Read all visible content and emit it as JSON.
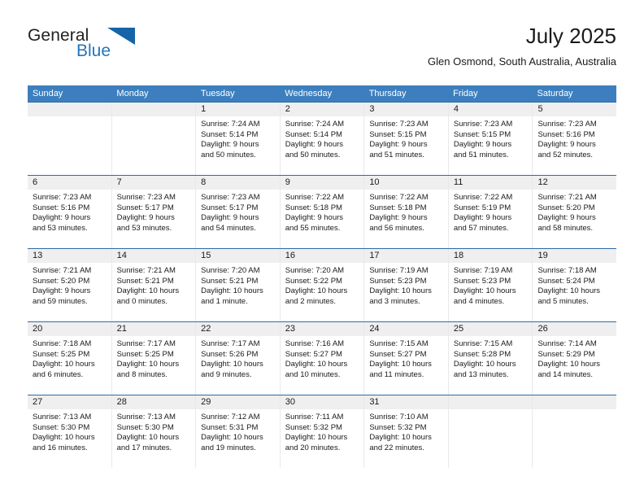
{
  "brand": {
    "word1": "General",
    "word2": "Blue",
    "triangle_color": "#1664a8",
    "blue_color": "#2176bd"
  },
  "header": {
    "title": "July 2025",
    "location": "Glen Osmond, South Australia, Australia"
  },
  "theme": {
    "header_row_bg": "#3d7fbe",
    "week_divider": "#2c6ca8",
    "daynum_strip_bg": "#efefef"
  },
  "weekdays": [
    "Sunday",
    "Monday",
    "Tuesday",
    "Wednesday",
    "Thursday",
    "Friday",
    "Saturday"
  ],
  "weeks": [
    [
      {
        "day": "",
        "sunrise": "",
        "sunset": "",
        "daylight1": "",
        "daylight2": ""
      },
      {
        "day": "",
        "sunrise": "",
        "sunset": "",
        "daylight1": "",
        "daylight2": ""
      },
      {
        "day": "1",
        "sunrise": "Sunrise: 7:24 AM",
        "sunset": "Sunset: 5:14 PM",
        "daylight1": "Daylight: 9 hours",
        "daylight2": "and 50 minutes."
      },
      {
        "day": "2",
        "sunrise": "Sunrise: 7:24 AM",
        "sunset": "Sunset: 5:14 PM",
        "daylight1": "Daylight: 9 hours",
        "daylight2": "and 50 minutes."
      },
      {
        "day": "3",
        "sunrise": "Sunrise: 7:23 AM",
        "sunset": "Sunset: 5:15 PM",
        "daylight1": "Daylight: 9 hours",
        "daylight2": "and 51 minutes."
      },
      {
        "day": "4",
        "sunrise": "Sunrise: 7:23 AM",
        "sunset": "Sunset: 5:15 PM",
        "daylight1": "Daylight: 9 hours",
        "daylight2": "and 51 minutes."
      },
      {
        "day": "5",
        "sunrise": "Sunrise: 7:23 AM",
        "sunset": "Sunset: 5:16 PM",
        "daylight1": "Daylight: 9 hours",
        "daylight2": "and 52 minutes."
      }
    ],
    [
      {
        "day": "6",
        "sunrise": "Sunrise: 7:23 AM",
        "sunset": "Sunset: 5:16 PM",
        "daylight1": "Daylight: 9 hours",
        "daylight2": "and 53 minutes."
      },
      {
        "day": "7",
        "sunrise": "Sunrise: 7:23 AM",
        "sunset": "Sunset: 5:17 PM",
        "daylight1": "Daylight: 9 hours",
        "daylight2": "and 53 minutes."
      },
      {
        "day": "8",
        "sunrise": "Sunrise: 7:23 AM",
        "sunset": "Sunset: 5:17 PM",
        "daylight1": "Daylight: 9 hours",
        "daylight2": "and 54 minutes."
      },
      {
        "day": "9",
        "sunrise": "Sunrise: 7:22 AM",
        "sunset": "Sunset: 5:18 PM",
        "daylight1": "Daylight: 9 hours",
        "daylight2": "and 55 minutes."
      },
      {
        "day": "10",
        "sunrise": "Sunrise: 7:22 AM",
        "sunset": "Sunset: 5:18 PM",
        "daylight1": "Daylight: 9 hours",
        "daylight2": "and 56 minutes."
      },
      {
        "day": "11",
        "sunrise": "Sunrise: 7:22 AM",
        "sunset": "Sunset: 5:19 PM",
        "daylight1": "Daylight: 9 hours",
        "daylight2": "and 57 minutes."
      },
      {
        "day": "12",
        "sunrise": "Sunrise: 7:21 AM",
        "sunset": "Sunset: 5:20 PM",
        "daylight1": "Daylight: 9 hours",
        "daylight2": "and 58 minutes."
      }
    ],
    [
      {
        "day": "13",
        "sunrise": "Sunrise: 7:21 AM",
        "sunset": "Sunset: 5:20 PM",
        "daylight1": "Daylight: 9 hours",
        "daylight2": "and 59 minutes."
      },
      {
        "day": "14",
        "sunrise": "Sunrise: 7:21 AM",
        "sunset": "Sunset: 5:21 PM",
        "daylight1": "Daylight: 10 hours",
        "daylight2": "and 0 minutes."
      },
      {
        "day": "15",
        "sunrise": "Sunrise: 7:20 AM",
        "sunset": "Sunset: 5:21 PM",
        "daylight1": "Daylight: 10 hours",
        "daylight2": "and 1 minute."
      },
      {
        "day": "16",
        "sunrise": "Sunrise: 7:20 AM",
        "sunset": "Sunset: 5:22 PM",
        "daylight1": "Daylight: 10 hours",
        "daylight2": "and 2 minutes."
      },
      {
        "day": "17",
        "sunrise": "Sunrise: 7:19 AM",
        "sunset": "Sunset: 5:23 PM",
        "daylight1": "Daylight: 10 hours",
        "daylight2": "and 3 minutes."
      },
      {
        "day": "18",
        "sunrise": "Sunrise: 7:19 AM",
        "sunset": "Sunset: 5:23 PM",
        "daylight1": "Daylight: 10 hours",
        "daylight2": "and 4 minutes."
      },
      {
        "day": "19",
        "sunrise": "Sunrise: 7:18 AM",
        "sunset": "Sunset: 5:24 PM",
        "daylight1": "Daylight: 10 hours",
        "daylight2": "and 5 minutes."
      }
    ],
    [
      {
        "day": "20",
        "sunrise": "Sunrise: 7:18 AM",
        "sunset": "Sunset: 5:25 PM",
        "daylight1": "Daylight: 10 hours",
        "daylight2": "and 6 minutes."
      },
      {
        "day": "21",
        "sunrise": "Sunrise: 7:17 AM",
        "sunset": "Sunset: 5:25 PM",
        "daylight1": "Daylight: 10 hours",
        "daylight2": "and 8 minutes."
      },
      {
        "day": "22",
        "sunrise": "Sunrise: 7:17 AM",
        "sunset": "Sunset: 5:26 PM",
        "daylight1": "Daylight: 10 hours",
        "daylight2": "and 9 minutes."
      },
      {
        "day": "23",
        "sunrise": "Sunrise: 7:16 AM",
        "sunset": "Sunset: 5:27 PM",
        "daylight1": "Daylight: 10 hours",
        "daylight2": "and 10 minutes."
      },
      {
        "day": "24",
        "sunrise": "Sunrise: 7:15 AM",
        "sunset": "Sunset: 5:27 PM",
        "daylight1": "Daylight: 10 hours",
        "daylight2": "and 11 minutes."
      },
      {
        "day": "25",
        "sunrise": "Sunrise: 7:15 AM",
        "sunset": "Sunset: 5:28 PM",
        "daylight1": "Daylight: 10 hours",
        "daylight2": "and 13 minutes."
      },
      {
        "day": "26",
        "sunrise": "Sunrise: 7:14 AM",
        "sunset": "Sunset: 5:29 PM",
        "daylight1": "Daylight: 10 hours",
        "daylight2": "and 14 minutes."
      }
    ],
    [
      {
        "day": "27",
        "sunrise": "Sunrise: 7:13 AM",
        "sunset": "Sunset: 5:30 PM",
        "daylight1": "Daylight: 10 hours",
        "daylight2": "and 16 minutes."
      },
      {
        "day": "28",
        "sunrise": "Sunrise: 7:13 AM",
        "sunset": "Sunset: 5:30 PM",
        "daylight1": "Daylight: 10 hours",
        "daylight2": "and 17 minutes."
      },
      {
        "day": "29",
        "sunrise": "Sunrise: 7:12 AM",
        "sunset": "Sunset: 5:31 PM",
        "daylight1": "Daylight: 10 hours",
        "daylight2": "and 19 minutes."
      },
      {
        "day": "30",
        "sunrise": "Sunrise: 7:11 AM",
        "sunset": "Sunset: 5:32 PM",
        "daylight1": "Daylight: 10 hours",
        "daylight2": "and 20 minutes."
      },
      {
        "day": "31",
        "sunrise": "Sunrise: 7:10 AM",
        "sunset": "Sunset: 5:32 PM",
        "daylight1": "Daylight: 10 hours",
        "daylight2": "and 22 minutes."
      },
      {
        "day": "",
        "sunrise": "",
        "sunset": "",
        "daylight1": "",
        "daylight2": ""
      },
      {
        "day": "",
        "sunrise": "",
        "sunset": "",
        "daylight1": "",
        "daylight2": ""
      }
    ]
  ]
}
